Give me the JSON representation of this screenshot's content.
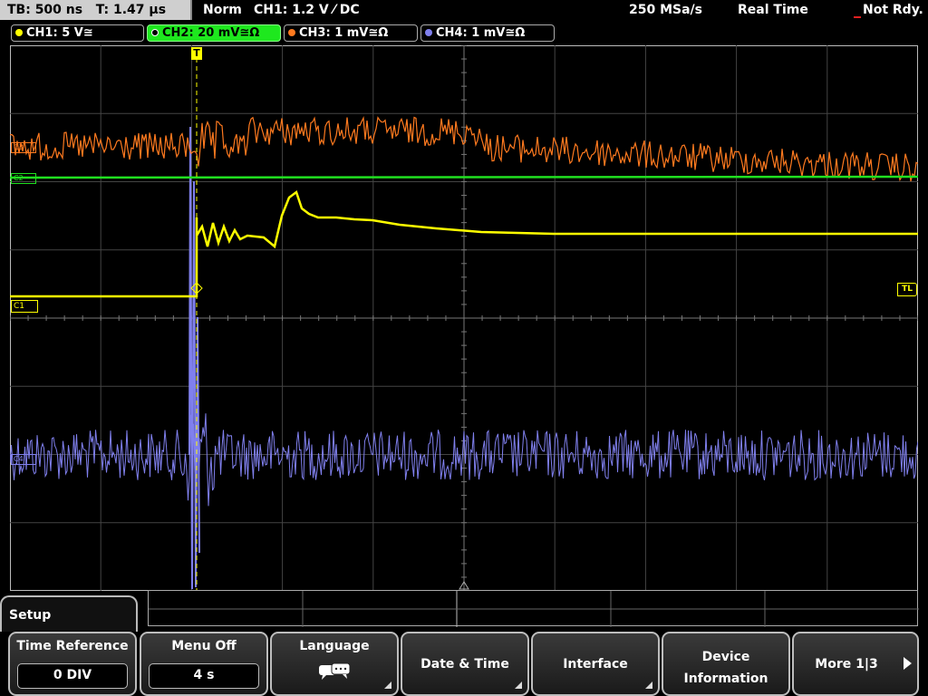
{
  "status": {
    "timebase": "TB: 500 ns",
    "trigger_time": "T: 1.47 µs",
    "mode": "Norm",
    "trigger": "CH1: 1.2 V ⁄ DC",
    "sample_rate": "250 MSa/s",
    "acq_mode": "Real Time",
    "state": "Not Rdy."
  },
  "channels": [
    {
      "label": "CH1: 5 V≅",
      "color": "#ffff00"
    },
    {
      "label": "CH2: 20 mV≅Ω",
      "color": "#20e020"
    },
    {
      "label": "CH3: 1 mV≅Ω",
      "color": "#ff7a1f"
    },
    {
      "label": "CH4: 1 mV≅Ω",
      "color": "#8080ee"
    }
  ],
  "markers": {
    "trigger_marker": "T",
    "trigger_level": "TL",
    "ch1_ref": "C1",
    "ch2_ref": "C2",
    "ch3_ref": "C3",
    "ch4_ref": "C4"
  },
  "menu": {
    "title": "Setup",
    "softkeys": [
      {
        "label": "Time Reference",
        "value": "0 DIV"
      },
      {
        "label": "Menu Off",
        "value": "4 s"
      },
      {
        "label": "Language",
        "icon": "speech-bubble-icon"
      },
      {
        "label": "Date & Time"
      },
      {
        "label": "Interface"
      },
      {
        "label": "Device Information"
      },
      {
        "label": "More 1|3"
      }
    ]
  },
  "chart_data": {
    "type": "line",
    "grid": true,
    "x_divisions": 10,
    "y_divisions": 8,
    "timebase_per_div": "500 ns",
    "series": [
      {
        "name": "CH1",
        "color": "#ffff00",
        "scale": "5 V/div",
        "description_values": "step from baseline to settled level at trigger"
      },
      {
        "name": "CH2",
        "color": "#20e020",
        "scale": "20 mV/div"
      },
      {
        "name": "CH3",
        "color": "#ff7a1f",
        "scale": "1 mV/div"
      },
      {
        "name": "CH4",
        "color": "#8080ee",
        "scale": "1 mV/div"
      }
    ]
  }
}
